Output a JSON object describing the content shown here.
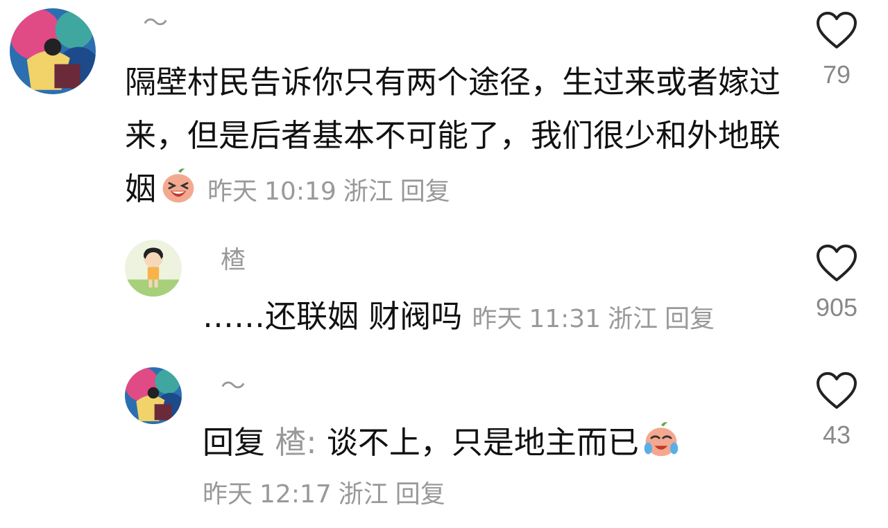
{
  "comments": [
    {
      "username": "～",
      "text": "隔壁村民告诉你只有两个途径，生过来或者嫁过来，但是后者基本不可能了，我们很少和外地联姻",
      "emoji": "laughing-emoji",
      "date": "昨天",
      "time": "10:19",
      "location": "浙江",
      "reply_label": "回复",
      "likes": "79",
      "avatar": "anime-art-avatar"
    },
    {
      "username": "楂",
      "text": "……还联姻 财阀吗",
      "date": "昨天",
      "time": "11:31",
      "location": "浙江",
      "reply_label": "回复",
      "likes": "905",
      "avatar": "cartoon-girl-avatar"
    },
    {
      "username": "～",
      "reply_prefix": "回复",
      "mention": "楂:",
      "text": "谈不上，只是地主而已",
      "emoji": "crying-laughing-emoji",
      "date": "昨天",
      "time": "12:17",
      "location": "浙江",
      "reply_label": "回复",
      "likes": "43",
      "avatar": "anime-art-avatar"
    }
  ],
  "colors": {
    "meta": "#999999",
    "text": "#111111",
    "heart": "#222222"
  }
}
